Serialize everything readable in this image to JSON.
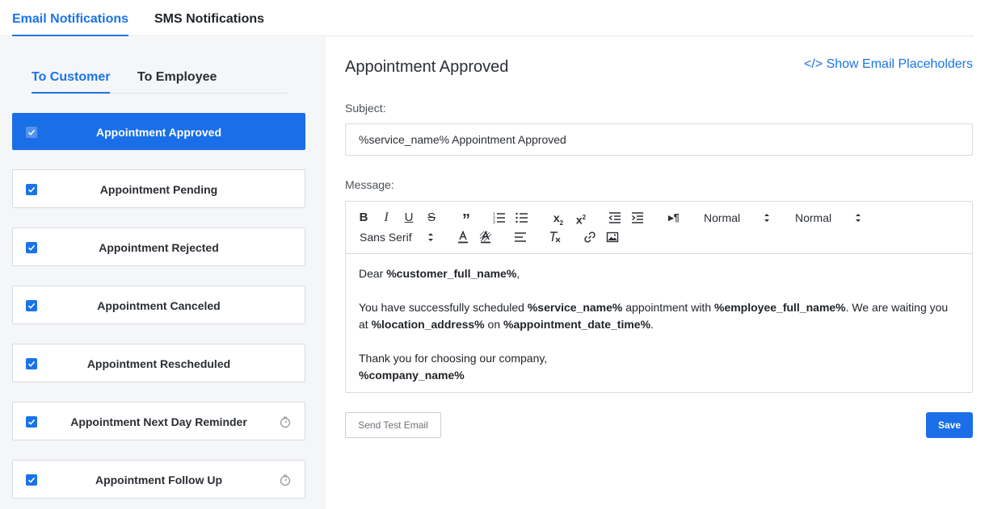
{
  "top_tabs": [
    {
      "label": "Email Notifications",
      "active": true
    },
    {
      "label": "SMS Notifications",
      "active": false
    }
  ],
  "sub_tabs": [
    {
      "label": "To Customer",
      "active": true
    },
    {
      "label": "To Employee",
      "active": false
    }
  ],
  "notifications": [
    {
      "label": "Appointment Approved",
      "checked": true,
      "active": true,
      "timer": false
    },
    {
      "label": "Appointment Pending",
      "checked": true,
      "active": false,
      "timer": false
    },
    {
      "label": "Appointment Rejected",
      "checked": true,
      "active": false,
      "timer": false
    },
    {
      "label": "Appointment Canceled",
      "checked": true,
      "active": false,
      "timer": false
    },
    {
      "label": "Appointment Rescheduled",
      "checked": true,
      "active": false,
      "timer": false
    },
    {
      "label": "Appointment Next Day Reminder",
      "checked": true,
      "active": false,
      "timer": true
    },
    {
      "label": "Appointment Follow Up",
      "checked": true,
      "active": false,
      "timer": true
    }
  ],
  "editor": {
    "title": "Appointment Approved",
    "placeholders_link": "</> Show Email Placeholders",
    "subject_label": "Subject:",
    "subject_value": "%service_name% Appointment Approved",
    "message_label": "Message:",
    "toolbar": {
      "header_select": "Normal",
      "size_select": "Normal",
      "font_select": "Sans Serif"
    },
    "body": {
      "greeting_prefix": "Dear ",
      "customer_ph": "%customer_full_name%",
      "greeting_suffix": ",",
      "l1_a": "You have successfully scheduled ",
      "service_ph": "%service_name%",
      "l1_b": " appointment with ",
      "employee_ph": "%employee_full_name%",
      "l1_c": ". We are waiting you",
      "l2_a": "at ",
      "location_ph": "%location_address%",
      "l2_b": " on ",
      "datetime_ph": "%appointment_date_time%",
      "l2_c": ".",
      "thanks": "Thank you for choosing our company,",
      "company_ph": "%company_name%"
    }
  },
  "buttons": {
    "send_test": "Send Test Email",
    "save": "Save"
  },
  "colors": {
    "accent": "#1a73e8",
    "panel_bg": "#f4f6f8"
  }
}
